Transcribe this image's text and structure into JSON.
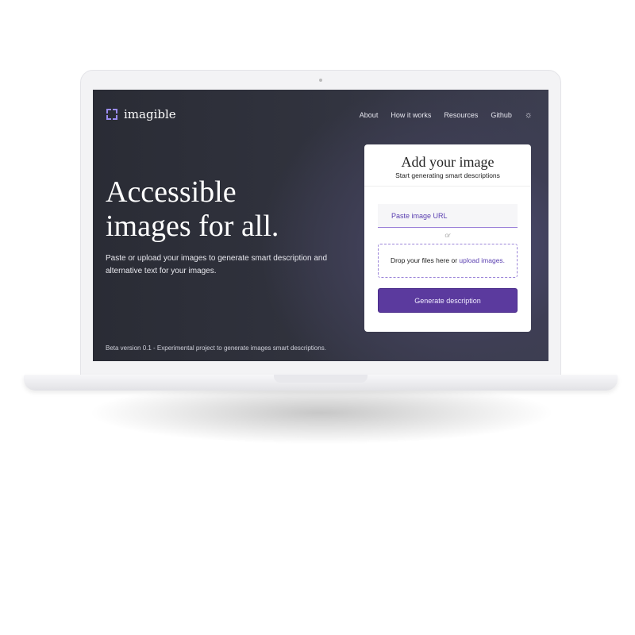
{
  "header": {
    "logo_text": "imagible",
    "nav": [
      "About",
      "How it works",
      "Resources",
      "Github"
    ],
    "theme_icon": "sun-icon"
  },
  "hero": {
    "title_line1": "Accessible",
    "title_line2": "images for all.",
    "subtitle": "Paste or upload your images to generate smart description and alternative text for your images."
  },
  "footer": {
    "text": "Beta version 0.1 - Experimental project to generate images smart descriptions."
  },
  "card": {
    "title": "Add your image",
    "subtitle": "Start generating smart descriptions",
    "url_placeholder": "Paste image URL",
    "or": "or",
    "drop_text": "Drop your files here or ",
    "upload_link": "upload images.",
    "button": "Generate description"
  },
  "colors": {
    "accent": "#5b3a9e",
    "background": "#2a2c35"
  }
}
